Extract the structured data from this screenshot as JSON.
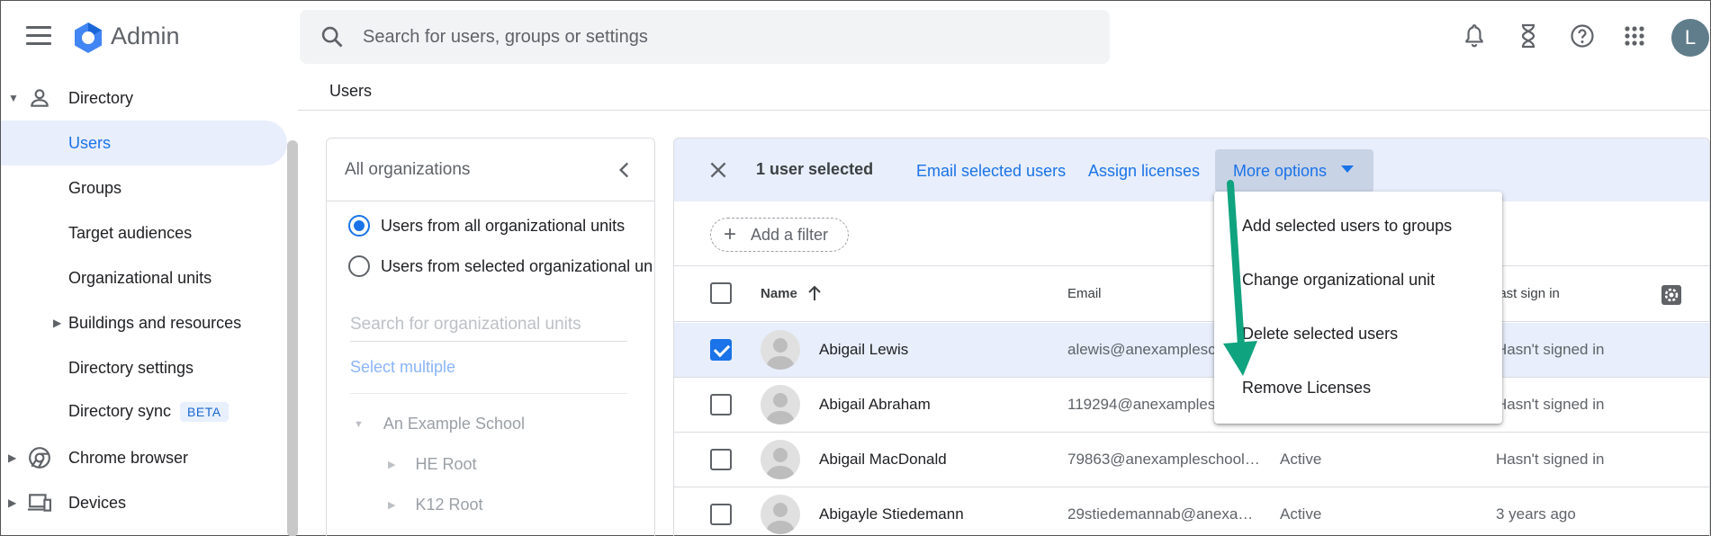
{
  "header": {
    "brand": "Admin",
    "search_placeholder": "Search for users, groups or settings",
    "avatar_letter": "L"
  },
  "sidebar": {
    "items": [
      {
        "label": "Directory"
      },
      {
        "label": "Users"
      },
      {
        "label": "Groups"
      },
      {
        "label": "Target audiences"
      },
      {
        "label": "Organizational units"
      },
      {
        "label": "Buildings and resources"
      },
      {
        "label": "Directory settings"
      },
      {
        "label": "Directory sync",
        "badge": "BETA"
      },
      {
        "label": "Chrome browser"
      },
      {
        "label": "Devices"
      }
    ]
  },
  "breadcrumb": "Users",
  "org_panel": {
    "title": "All organizations",
    "radio_all": "Users from all organizational units",
    "radio_selected": "Users from selected organizational un",
    "search_placeholder": "Search for organizational units",
    "select_multiple": "Select multiple",
    "tree": [
      "An Example School",
      "HE Root",
      "K12 Root"
    ]
  },
  "users_panel": {
    "selected_count": "1 user selected",
    "email_selected": "Email selected users",
    "assign_licenses": "Assign licenses",
    "more_options": "More options",
    "add_filter": "Add a filter",
    "columns": {
      "name": "Name",
      "email": "Email",
      "last_sign_in": "Last sign in"
    },
    "rows": [
      {
        "name": "Abigail Lewis",
        "email": "alewis@anexamplesch",
        "status": "",
        "last_sign_in": "Hasn't signed in",
        "selected": true
      },
      {
        "name": "Abigail Abraham",
        "email": "119294@anexamplesc",
        "status": "",
        "last_sign_in": "Hasn't signed in",
        "selected": false
      },
      {
        "name": "Abigail MacDonald",
        "email": "79863@anexampleschool.c...",
        "status": "Active",
        "last_sign_in": "Hasn't signed in",
        "selected": false
      },
      {
        "name": "Abigayle Stiedemann",
        "email": "29stiedemannab@anexam...",
        "status": "Active",
        "last_sign_in": "3 years ago",
        "selected": false
      }
    ]
  },
  "more_menu": {
    "items": [
      "Add selected users to groups",
      "Change organizational unit",
      "Delete selected users",
      "Remove Licenses"
    ]
  },
  "colors": {
    "accent": "#1a73e8",
    "selected_bg": "#e8eefb",
    "annotation_arrow": "#10a37f"
  }
}
